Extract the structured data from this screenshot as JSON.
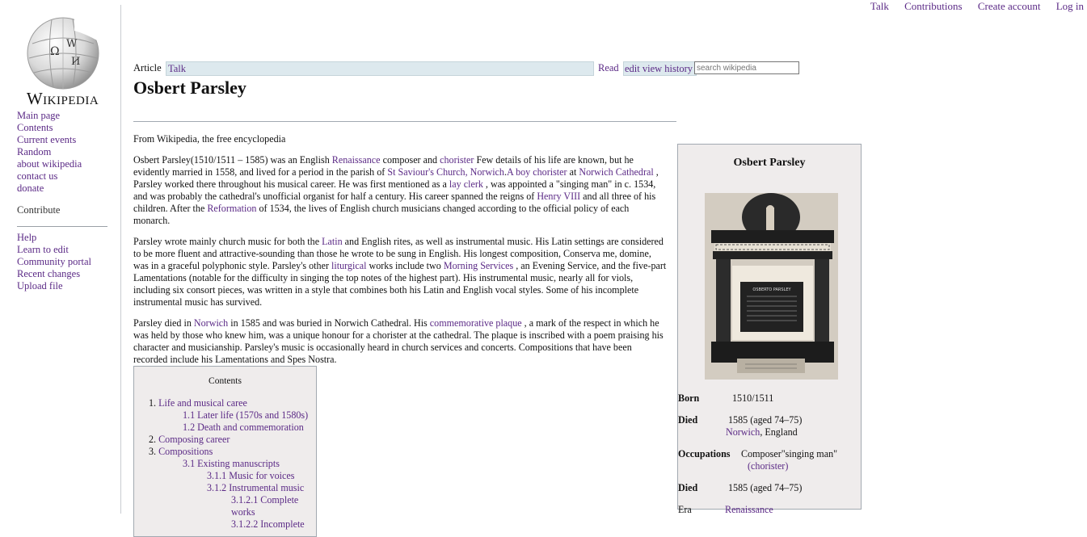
{
  "top_nav": [
    "Talk",
    "Contributions",
    "Create account",
    "Log in"
  ],
  "logo": {
    "wordmark": "Wikipedia",
    "globe_glyphs": [
      "Ω",
      "W",
      "И"
    ]
  },
  "sidebar": {
    "nav": [
      "Main page",
      "Contents",
      "Current events",
      "Random",
      "about wikipedia",
      "contact us",
      "donate"
    ],
    "contribute_heading": "Contribute",
    "tools": [
      "Help",
      "Learn to edit",
      "Community portal",
      "Recent changes",
      "Upload file"
    ]
  },
  "tabs": {
    "article": "Article",
    "talk": "Talk",
    "read": "Read",
    "edit": "edit",
    "view_history": "view history",
    "search_placeholder": "search wikipedia"
  },
  "page": {
    "title": "Osbert Parsley",
    "subtitle": "From Wikipedia, the free encyclopedia"
  },
  "paragraphs": {
    "p1": [
      {
        "t": "Osbert Parsley(1510/1511 – 1585) was an English "
      },
      {
        "t": "Renaissance",
        "link": true
      },
      {
        "t": " composer and "
      },
      {
        "t": "chorister",
        "link": true
      },
      {
        "t": " Few details of his life are known, but he evidently married in 1558, and lived for a period in the parish of "
      },
      {
        "t": "St Saviour's Church, Norwich",
        "link": true
      },
      {
        "t": "."
      },
      {
        "t": "A boy chorister",
        "link": true
      },
      {
        "t": " at "
      },
      {
        "t": "Norwich Cathedral",
        "link": true
      },
      {
        "t": " , Parsley worked there throughout his musical career. He was first mentioned as a "
      },
      {
        "t": "lay clerk",
        "link": true
      },
      {
        "t": " , was appointed a \"singing man\" in c. 1534, and was probably the cathedral's unofficial organist for half a century. His career spanned the reigns of "
      },
      {
        "t": "Henry VIII",
        "link": true
      },
      {
        "t": " and all three of his children. After the "
      },
      {
        "t": "Reformation",
        "link": true
      },
      {
        "t": " of 1534, the lives of English church musicians changed according to the official policy of each monarch."
      }
    ],
    "p2": [
      {
        "t": "Parsley wrote mainly church music for both the "
      },
      {
        "t": "Latin",
        "link": true
      },
      {
        "t": " and English rites, as well as instrumental music. His Latin settings are considered to be more fluent and attractive-sounding than those he wrote to be sung in English. His longest composition, Conserva me, domine, was in a graceful polyphonic style. Parsley's other "
      },
      {
        "t": "liturgical",
        "link": true
      },
      {
        "t": " works include two "
      },
      {
        "t": "Morning Services",
        "link": true
      },
      {
        "t": " , an Evening Service, and the five-part Lamentations (notable for the difficulty in singing the top notes of the highest part). His instrumental music, nearly all for viols, including six consort pieces, was written in a style that combines both his Latin and English vocal styles. Some of his incomplete instrumental music has survived."
      }
    ],
    "p3": [
      {
        "t": "Parsley died in "
      },
      {
        "t": "Norwich",
        "link": true
      },
      {
        "t": " in 1585 and was buried in Norwich Cathedral. His "
      },
      {
        "t": "commemorative plaque",
        "link": true
      },
      {
        "t": " , a mark of the respect in which he was held by those who knew him, was a unique honour for a chorister at the cathedral. The plaque is inscribed with a poem praising his character and musicianship. Parsley's music is occasionally heard in church services and concerts. Compositions that have been recorded include his Lamentations and Spes Nostra."
      }
    ]
  },
  "toc": {
    "title": "Contents",
    "items": [
      {
        "num": "1.",
        "label": "Life and musical caree",
        "level": 0
      },
      {
        "num": "",
        "label": "1.1 Later life (1570s and 1580s)",
        "level": 1
      },
      {
        "num": "",
        "label": "1.2 Death and commemoration",
        "level": 1
      },
      {
        "num": "2.",
        "label": "Composing career",
        "level": 0
      },
      {
        "num": "3.",
        "label": "Compositions",
        "level": 0
      },
      {
        "num": "",
        "label": "3.1 Existing manuscripts",
        "level": 1
      },
      {
        "num": "",
        "label": "3.1.1 Music for voices",
        "level": 2
      },
      {
        "num": "",
        "label": "3.1.2 Instrumental music",
        "level": 2
      },
      {
        "num": "",
        "label": "3.1.2.1 Complete works",
        "level": 3
      },
      {
        "num": "",
        "label": "3.1.2.2 Incomplete",
        "level": 3
      }
    ]
  },
  "infobox": {
    "title": "Osbert Parsley",
    "plaque_text": "OSBERTO PARSLEY",
    "born_label": "Born",
    "born_value": "1510/1511",
    "died_label": "Died",
    "died_value": "1585 (aged 74–75)",
    "died_place_link": "Norwich",
    "died_place_rest": ", England",
    "occupations_label": "Occupations",
    "occupations_value": "Composer\"singing man\"",
    "occupations_link": "(chorister)",
    "died2_label": "Died",
    "died2_value": "1585 (aged 74–75)",
    "era_label": "Era",
    "era_value": "Renaissance"
  },
  "colors": {
    "link": "#5b2a86",
    "tab_bg": "#dde9ee",
    "box_bg": "#efecec",
    "border": "#a2a9b1"
  }
}
